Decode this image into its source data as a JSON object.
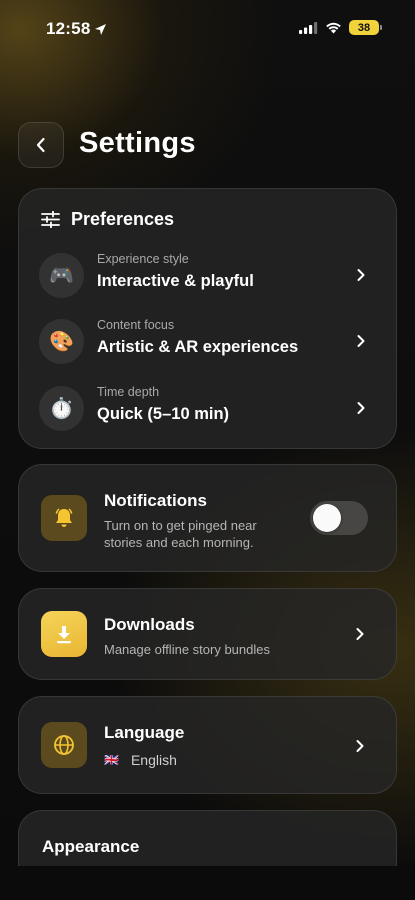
{
  "status_bar": {
    "time": "12:58",
    "battery": "38",
    "battery_color": "#f0d23a"
  },
  "header": {
    "title": "Settings",
    "back_icon": "chevron-left-icon"
  },
  "preferences": {
    "title": "Preferences",
    "icon": "sliders-icon",
    "items": [
      {
        "label": "Experience style",
        "value": "Interactive & playful",
        "emoji": "🎮",
        "icon": "game-controller-icon"
      },
      {
        "label": "Content focus",
        "value": "Artistic & AR experiences",
        "emoji": "🎨",
        "icon": "palette-icon"
      },
      {
        "label": "Time depth",
        "value": "Quick (5–10 min)",
        "emoji": "⏱️",
        "icon": "stopwatch-icon"
      }
    ]
  },
  "notifications": {
    "title": "Notifications",
    "subtitle_line1": "Turn on to get pinged near",
    "subtitle_line2": "stories and each morning.",
    "toggle_on": false,
    "icon": "bell-icon"
  },
  "downloads": {
    "title": "Downloads",
    "subtitle": "Manage offline story bundles",
    "icon": "download-icon"
  },
  "language": {
    "title": "Language",
    "value": "English",
    "flag": "🇬🇧",
    "icon": "globe-icon"
  },
  "appearance": {
    "title": "Appearance"
  },
  "accent_color": "#f2c94c"
}
